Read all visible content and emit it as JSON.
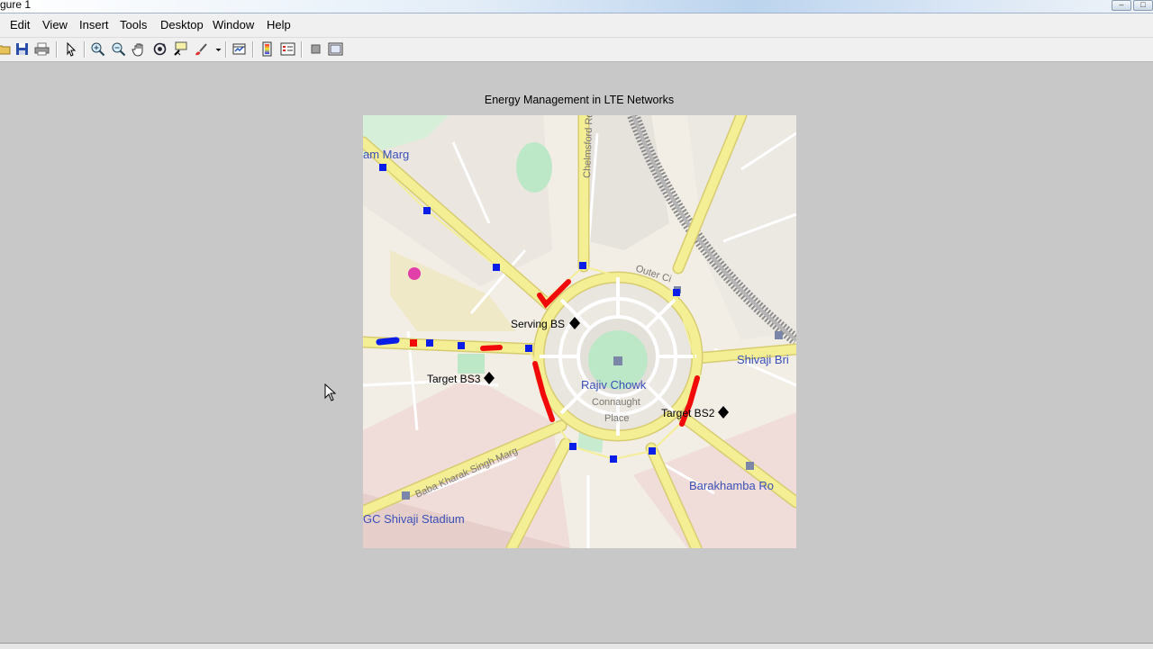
{
  "window": {
    "title": "gure 1"
  },
  "menu": [
    "Edit",
    "View",
    "Insert",
    "Tools",
    "Desktop",
    "Window",
    "Help"
  ],
  "toolbar": {
    "icons": [
      "open-icon",
      "save-icon",
      "print-icon",
      "edit-plot-icon",
      "zoom-in-icon",
      "zoom-out-icon",
      "pan-icon",
      "rotate-3d-icon",
      "data-cursor-icon",
      "brush-icon",
      "link-plot-icon",
      "insert-colorbar-icon",
      "insert-legend-icon",
      "hide-plot-tools-icon",
      "show-plot-tools-icon"
    ]
  },
  "figure": {
    "title": "Energy Management in LTE Networks",
    "labels": {
      "serving": "Serving BS",
      "target3": "Target BS3",
      "target2": "Target BS2"
    },
    "map_labels": {
      "marg": "am Marg",
      "shivaji_bridge": "Shivaji Bri",
      "rajiv_chowk": "Rajiv Chowk",
      "connaught": "Connaught",
      "place": "Place",
      "barakhamba": "Barakhamba Ro",
      "stadium": "GC Shivaji Stadium",
      "outer_circle": "Outer Ci",
      "baba_kharak": "Baba Kharak Singh Marg",
      "chelmsford": "Chelmsford Rd"
    },
    "colors": {
      "road_yellow": "#f4ee95",
      "route_blue": "#0a1ee8",
      "route_red": "#f20a0a",
      "marker": "#000000",
      "park": "#bde8c8"
    }
  }
}
